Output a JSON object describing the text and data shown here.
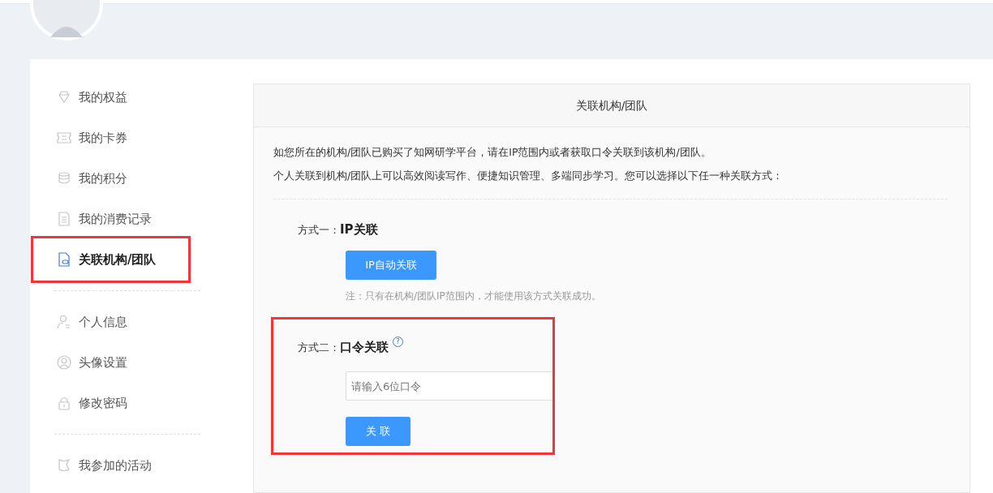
{
  "sidebar": {
    "groups": [
      {
        "items": [
          {
            "label": "我的权益",
            "selected": false,
            "highlighted": false
          },
          {
            "label": "我的卡券",
            "selected": false,
            "highlighted": false
          },
          {
            "label": "我的积分",
            "selected": false,
            "highlighted": false
          },
          {
            "label": "我的消费记录",
            "selected": false,
            "highlighted": false
          },
          {
            "label": "关联机构/团队",
            "selected": true,
            "highlighted": true
          }
        ]
      },
      {
        "items": [
          {
            "label": "个人信息",
            "selected": false,
            "highlighted": false
          },
          {
            "label": "头像设置",
            "selected": false,
            "highlighted": false
          },
          {
            "label": "修改密码",
            "selected": false,
            "highlighted": false
          }
        ]
      },
      {
        "items": [
          {
            "label": "我参加的活动",
            "selected": false,
            "highlighted": false
          }
        ]
      }
    ]
  },
  "panel": {
    "title": "关联机构/团队",
    "intro": [
      "如您所在的机构/团队已购买了知网研学平台，请在IP范围内或者获取口令关联到该机构/团队。",
      "个人关联到机构/团队上可以高效阅读写作、便捷知识管理、多端同步学习。您可以选择以下任一种关联方式："
    ],
    "methods": [
      {
        "kind": "button",
        "label": "方式一：",
        "name": "IP关联",
        "highlighted": false,
        "button": "IP自动关联",
        "note": "注：只有在机构/团队IP范围内，才能使用该方式关联成功。"
      },
      {
        "kind": "code",
        "label": "方式二：",
        "name": "口令关联",
        "highlighted": true,
        "help": "?",
        "placeholder": "请输入6位口令",
        "button": "关 联"
      }
    ]
  }
}
